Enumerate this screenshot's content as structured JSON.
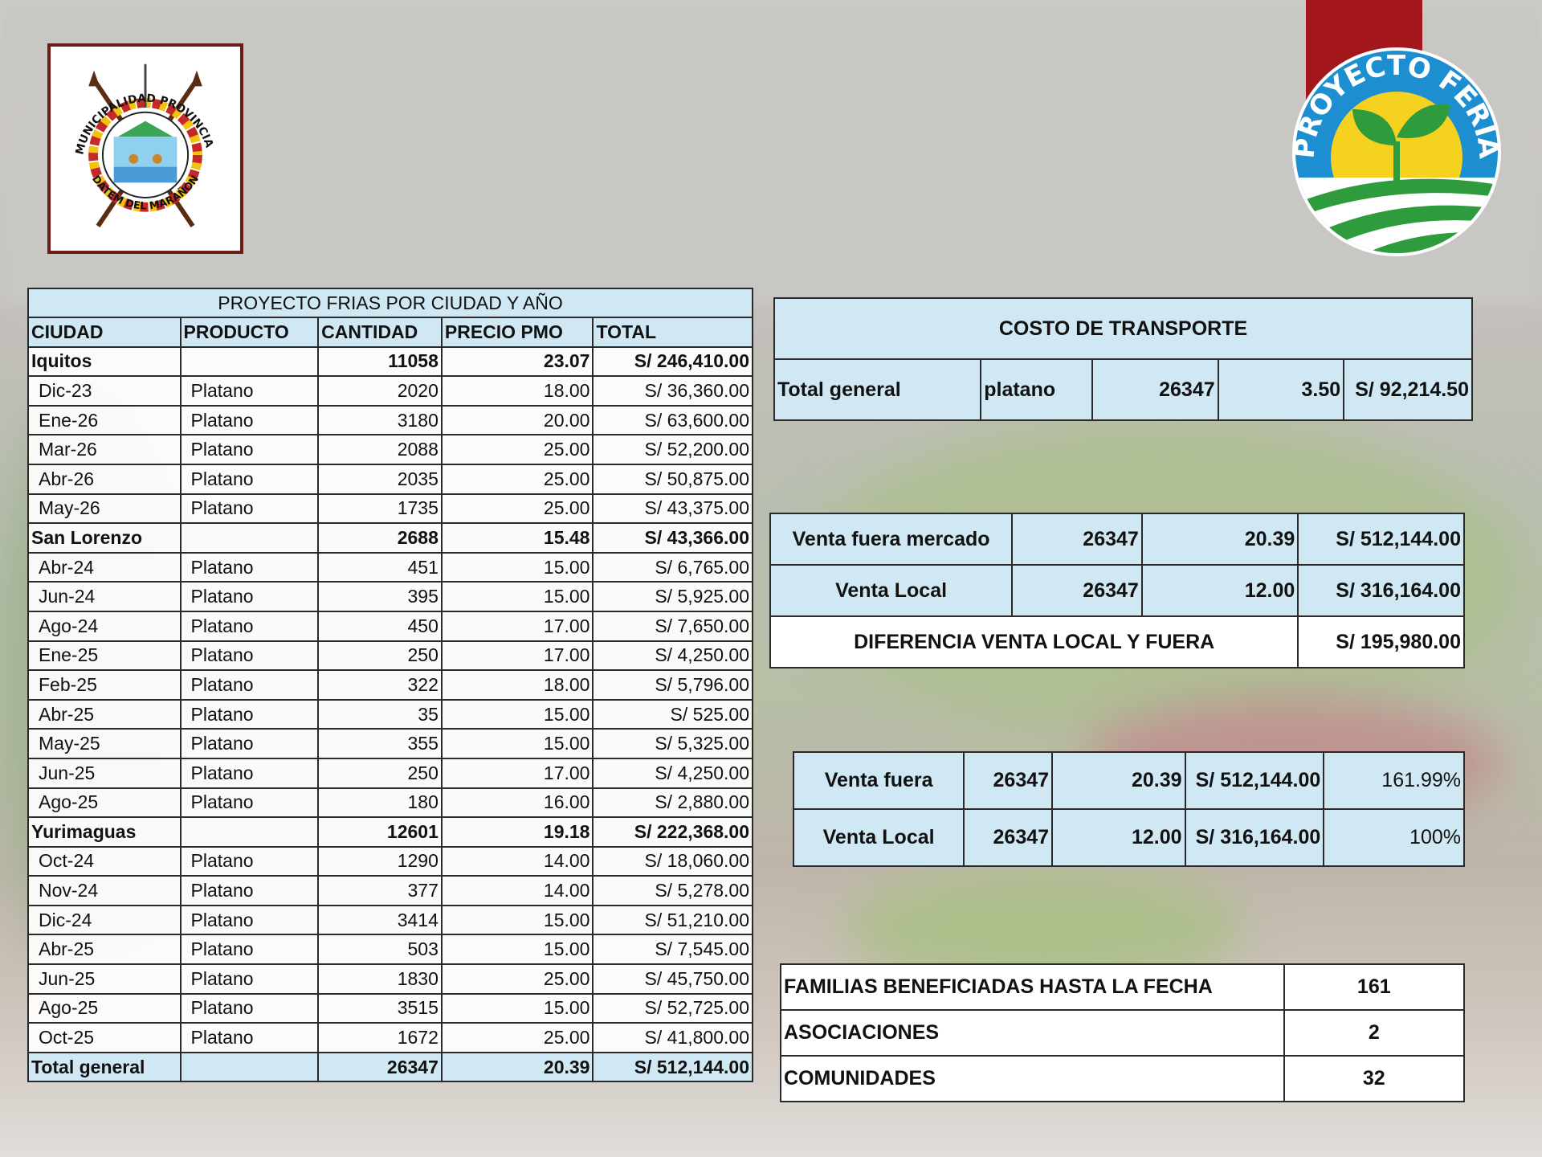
{
  "main_table": {
    "title": "PROYECTO FRIAS POR CIUDAD Y AÑO",
    "headers": [
      "CIUDAD",
      "PRODUCTO",
      "CANTIDAD",
      "PRECIO PMO",
      "TOTAL"
    ],
    "rows": [
      {
        "type": "group",
        "ciudad": "Iquitos",
        "producto": "",
        "cantidad": "11058",
        "precio": "23.07",
        "total": "S/ 246,410.00"
      },
      {
        "type": "item",
        "ciudad": "Dic-23",
        "producto": "Platano",
        "cantidad": "2020",
        "precio": "18.00",
        "total": "S/ 36,360.00"
      },
      {
        "type": "item",
        "ciudad": "Ene-26",
        "producto": "Platano",
        "cantidad": "3180",
        "precio": "20.00",
        "total": "S/ 63,600.00"
      },
      {
        "type": "item",
        "ciudad": "Mar-26",
        "producto": "Platano",
        "cantidad": "2088",
        "precio": "25.00",
        "total": "S/ 52,200.00"
      },
      {
        "type": "item",
        "ciudad": "Abr-26",
        "producto": "Platano",
        "cantidad": "2035",
        "precio": "25.00",
        "total": "S/ 50,875.00"
      },
      {
        "type": "item",
        "ciudad": "May-26",
        "producto": "Platano",
        "cantidad": "1735",
        "precio": "25.00",
        "total": "S/ 43,375.00"
      },
      {
        "type": "group",
        "ciudad": "San Lorenzo",
        "producto": "",
        "cantidad": "2688",
        "precio": "15.48",
        "total": "S/ 43,366.00"
      },
      {
        "type": "item",
        "ciudad": "Abr-24",
        "producto": "Platano",
        "cantidad": "451",
        "precio": "15.00",
        "total": "S/ 6,765.00"
      },
      {
        "type": "item",
        "ciudad": "Jun-24",
        "producto": "Platano",
        "cantidad": "395",
        "precio": "15.00",
        "total": "S/ 5,925.00"
      },
      {
        "type": "item",
        "ciudad": "Ago-24",
        "producto": "Platano",
        "cantidad": "450",
        "precio": "17.00",
        "total": "S/ 7,650.00"
      },
      {
        "type": "item",
        "ciudad": "Ene-25",
        "producto": "Platano",
        "cantidad": "250",
        "precio": "17.00",
        "total": "S/ 4,250.00"
      },
      {
        "type": "item",
        "ciudad": "Feb-25",
        "producto": "Platano",
        "cantidad": "322",
        "precio": "18.00",
        "total": "S/ 5,796.00"
      },
      {
        "type": "item",
        "ciudad": "Abr-25",
        "producto": "Platano",
        "cantidad": "35",
        "precio": "15.00",
        "total": "S/ 525.00"
      },
      {
        "type": "item",
        "ciudad": "May-25",
        "producto": "Platano",
        "cantidad": "355",
        "precio": "15.00",
        "total": "S/ 5,325.00"
      },
      {
        "type": "item",
        "ciudad": "Jun-25",
        "producto": "Platano",
        "cantidad": "250",
        "precio": "17.00",
        "total": "S/ 4,250.00"
      },
      {
        "type": "item",
        "ciudad": "Ago-25",
        "producto": "Platano",
        "cantidad": "180",
        "precio": "16.00",
        "total": "S/ 2,880.00"
      },
      {
        "type": "group",
        "ciudad": "Yurimaguas",
        "producto": "",
        "cantidad": "12601",
        "precio": "19.18",
        "total": "S/ 222,368.00"
      },
      {
        "type": "item",
        "ciudad": "Oct-24",
        "producto": "Platano",
        "cantidad": "1290",
        "precio": "14.00",
        "total": "S/ 18,060.00"
      },
      {
        "type": "item",
        "ciudad": "Nov-24",
        "producto": "Platano",
        "cantidad": "377",
        "precio": "14.00",
        "total": "S/ 5,278.00"
      },
      {
        "type": "item",
        "ciudad": "Dic-24",
        "producto": "Platano",
        "cantidad": "3414",
        "precio": "15.00",
        "total": "S/ 51,210.00"
      },
      {
        "type": "item",
        "ciudad": "Abr-25",
        "producto": "Platano",
        "cantidad": "503",
        "precio": "15.00",
        "total": "S/ 7,545.00"
      },
      {
        "type": "item",
        "ciudad": "Jun-25",
        "producto": "Platano",
        "cantidad": "1830",
        "precio": "25.00",
        "total": "S/ 45,750.00"
      },
      {
        "type": "item",
        "ciudad": "Ago-25",
        "producto": "Platano",
        "cantidad": "3515",
        "precio": "15.00",
        "total": "S/ 52,725.00"
      },
      {
        "type": "item",
        "ciudad": "Oct-25",
        "producto": "Platano",
        "cantidad": "1672",
        "precio": "25.00",
        "total": "S/ 41,800.00"
      },
      {
        "type": "total",
        "ciudad": "Total general",
        "producto": "",
        "cantidad": "26347",
        "precio": "20.39",
        "total": "S/ 512,144.00"
      }
    ]
  },
  "transporte": {
    "title": "COSTO DE TRANSPORTE",
    "label": "Total general",
    "producto": "platano",
    "cantidad": "26347",
    "precio": "3.50",
    "total": "S/ 92,214.50"
  },
  "ventas": {
    "fuera_mercado": {
      "label": "Venta fuera mercado",
      "cantidad": "26347",
      "precio": "20.39",
      "total": "S/ 512,144.00"
    },
    "local": {
      "label": "Venta Local",
      "cantidad": "26347",
      "precio": "12.00",
      "total": "S/ 316,164.00"
    },
    "diferencia": {
      "label": "DIFERENCIA VENTA LOCAL Y FUERA",
      "total": "S/ 195,980.00"
    }
  },
  "comparacion": {
    "fuera": {
      "label": "Venta fuera",
      "cantidad": "26347",
      "precio": "20.39",
      "total": "S/ 512,144.00",
      "pct": "161.99%"
    },
    "local": {
      "label": "Venta Local",
      "cantidad": "26347",
      "precio": "12.00",
      "total": "S/ 316,164.00",
      "pct": "100%"
    }
  },
  "resumen": {
    "familias": {
      "label": "FAMILIAS BENEFICIADAS HASTA LA FECHA",
      "value": "161"
    },
    "asociaciones": {
      "label": "ASOCIACIONES",
      "value": "2"
    },
    "comunidades": {
      "label": "COMUNIDADES",
      "value": "32"
    }
  },
  "logos": {
    "muni_top": "MUNICIPALIDAD PROVINCIAL",
    "muni_bottom": "DATEM DEL MARAÑON",
    "feria": "PROYECTO FERIA"
  },
  "colors": {
    "table_header": "#cfe8f4",
    "brand_red": "#a3161b",
    "feria_blue": "#1d8fd1",
    "feria_green": "#2e9b3c",
    "feria_yellow": "#f4d21f"
  }
}
